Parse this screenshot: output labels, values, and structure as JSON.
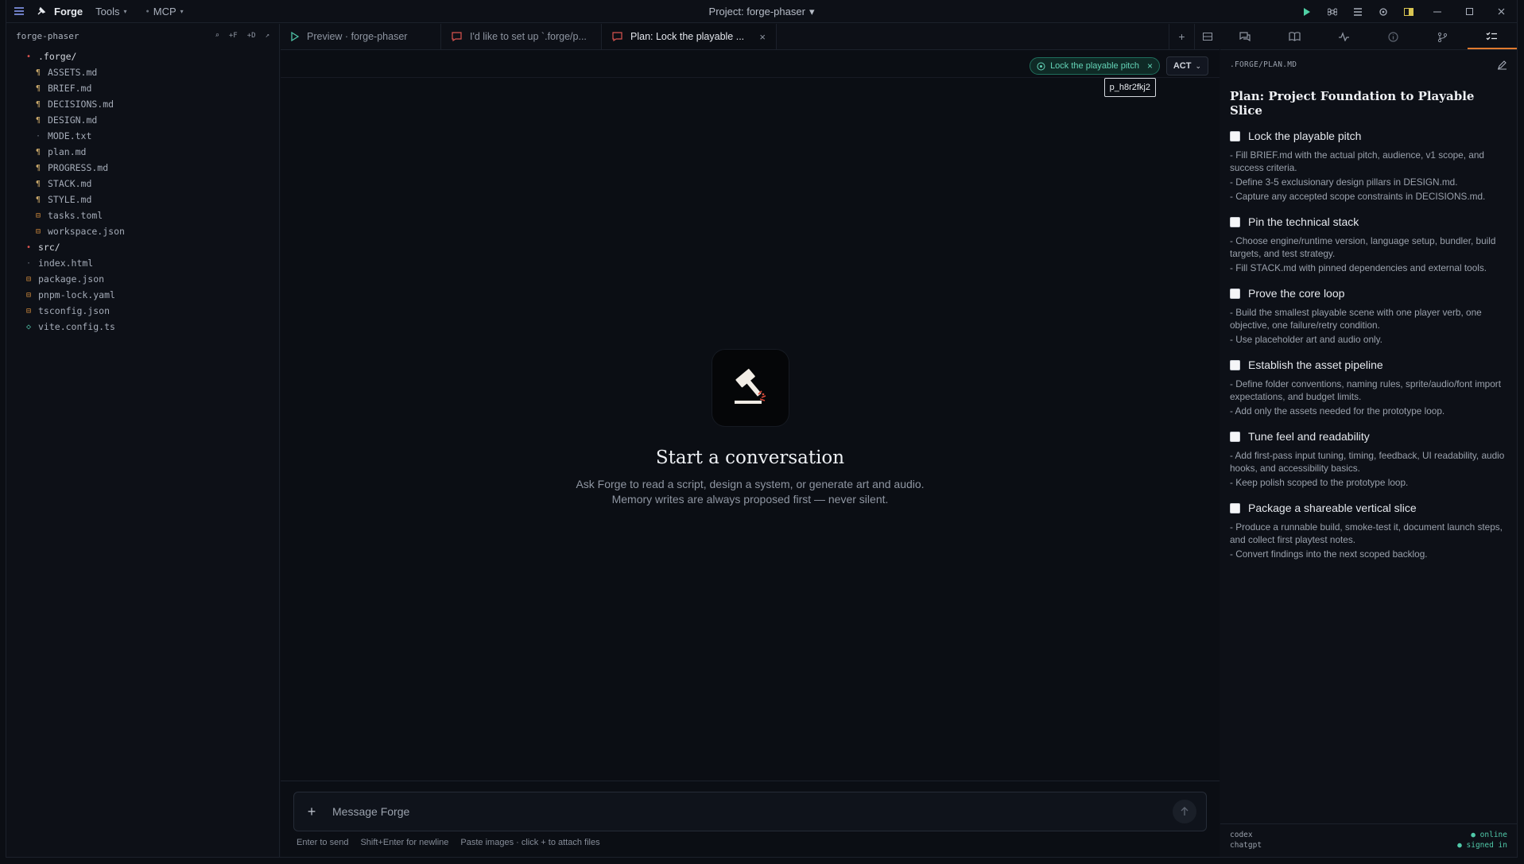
{
  "titlebar": {
    "brand": "Forge",
    "menus": [
      "Tools",
      "MCP"
    ],
    "project_title": "Project: forge-phaser"
  },
  "sidebar": {
    "title": "forge-phaser",
    "actions": [
      "⌕",
      "+F",
      "+D",
      "↗"
    ],
    "tree": [
      {
        "name": ".forge/",
        "type": "folder",
        "depth": 0,
        "icon": "dot"
      },
      {
        "name": "ASSETS.md",
        "type": "md",
        "depth": 1
      },
      {
        "name": "BRIEF.md",
        "type": "md",
        "depth": 1
      },
      {
        "name": "DECISIONS.md",
        "type": "md",
        "depth": 1
      },
      {
        "name": "DESIGN.md",
        "type": "md",
        "depth": 1
      },
      {
        "name": "MODE.txt",
        "type": "txt",
        "depth": 1
      },
      {
        "name": "plan.md",
        "type": "md",
        "depth": 1
      },
      {
        "name": "PROGRESS.md",
        "type": "md",
        "depth": 1
      },
      {
        "name": "STACK.md",
        "type": "md",
        "depth": 1
      },
      {
        "name": "STYLE.md",
        "type": "md",
        "depth": 1
      },
      {
        "name": "tasks.toml",
        "type": "config",
        "depth": 1
      },
      {
        "name": "workspace.json",
        "type": "config",
        "depth": 1
      },
      {
        "name": "src/",
        "type": "folder",
        "depth": 0,
        "icon": "dot"
      },
      {
        "name": "index.html",
        "type": "txt",
        "depth": 0
      },
      {
        "name": "package.json",
        "type": "config",
        "depth": 0
      },
      {
        "name": "pnpm-lock.yaml",
        "type": "config",
        "depth": 0
      },
      {
        "name": "tsconfig.json",
        "type": "config",
        "depth": 0
      },
      {
        "name": "vite.config.ts",
        "type": "ts",
        "depth": 0
      }
    ]
  },
  "tabs": [
    {
      "label": "Preview · forge-phaser",
      "kind": "preview"
    },
    {
      "label": "I'd like to set up `.forge/p...",
      "kind": "chat"
    },
    {
      "label": "Plan: Lock the playable ...",
      "kind": "chat",
      "active": true
    }
  ],
  "toolbar": {
    "pill": "Lock the playable pitch",
    "mode": "ACT",
    "tooltip": "p_h8r2fkj2"
  },
  "empty": {
    "title": "Start a conversation",
    "subtitle": "Ask Forge to read a script, design a system, or generate art and audio. Memory writes are always proposed first — never silent."
  },
  "composer": {
    "placeholder": "Message Forge",
    "hints": [
      "Enter to send",
      "Shift+Enter for newline",
      "Paste images · click + to attach files"
    ]
  },
  "right": {
    "path": ".FORGE/PLAN.MD",
    "heading": "Plan: Project Foundation to Playable Slice",
    "steps": [
      {
        "title": "Lock the playable pitch",
        "lines": [
          "- Fill BRIEF.md with the actual pitch, audience, v1 scope, and success criteria.",
          "- Define 3-5 exclusionary design pillars in DESIGN.md.",
          "- Capture any accepted scope constraints in DECISIONS.md."
        ]
      },
      {
        "title": "Pin the technical stack",
        "lines": [
          "- Choose engine/runtime version, language setup, bundler, build targets, and test strategy.",
          "- Fill STACK.md with pinned dependencies and external tools."
        ]
      },
      {
        "title": "Prove the core loop",
        "lines": [
          "- Build the smallest playable scene with one player verb, one objective, one failure/retry condition.",
          "- Use placeholder art and audio only."
        ]
      },
      {
        "title": "Establish the asset pipeline",
        "lines": [
          "- Define folder conventions, naming rules, sprite/audio/font import expectations, and budget limits.",
          "- Add only the assets needed for the prototype loop."
        ]
      },
      {
        "title": "Tune feel and readability",
        "lines": [
          "- Add first-pass input tuning, timing, feedback, UI readability, audio hooks, and accessibility basics.",
          "- Keep polish scoped to the prototype loop."
        ]
      },
      {
        "title": "Package a shareable vertical slice",
        "lines": [
          "- Produce a runnable build, smoke-test it, document launch steps, and collect first playtest notes.",
          "- Convert findings into the next scoped backlog."
        ]
      }
    ],
    "footer": [
      {
        "name": "codex",
        "status": "● online"
      },
      {
        "name": "chatgpt",
        "status": "● signed in"
      }
    ]
  },
  "colors": {
    "accent": "#e07a2f",
    "success": "#50c9a9",
    "chat_icon": "#d9534f",
    "preview_icon": "#4fc1a6"
  }
}
